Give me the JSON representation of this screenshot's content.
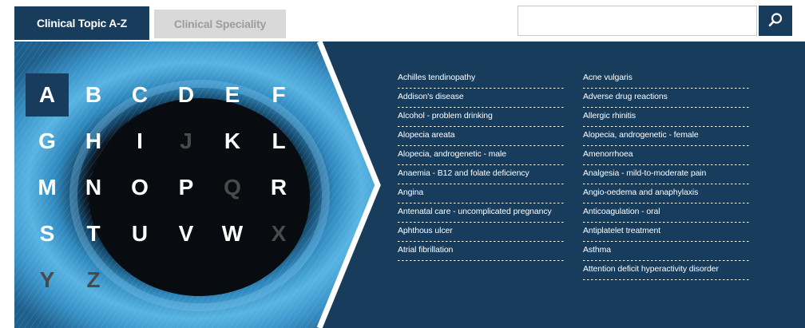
{
  "tabs": [
    {
      "label": "Clinical Topic A-Z",
      "active": true
    },
    {
      "label": "Clinical Speciality",
      "active": false
    }
  ],
  "search": {
    "placeholder": "",
    "icon": "search-icon"
  },
  "colors": {
    "navy": "#173c5c",
    "tab_inactive_bg": "#d9d9d9",
    "tab_inactive_text": "#9d9d9d",
    "eye_blue": "#3f9fd2"
  },
  "letters": [
    {
      "letter": "A",
      "state": "active"
    },
    {
      "letter": "B",
      "state": "enabled"
    },
    {
      "letter": "C",
      "state": "enabled"
    },
    {
      "letter": "D",
      "state": "enabled"
    },
    {
      "letter": "E",
      "state": "enabled"
    },
    {
      "letter": "F",
      "state": "enabled"
    },
    {
      "letter": "G",
      "state": "enabled"
    },
    {
      "letter": "H",
      "state": "enabled"
    },
    {
      "letter": "I",
      "state": "enabled"
    },
    {
      "letter": "J",
      "state": "disabled"
    },
    {
      "letter": "K",
      "state": "enabled"
    },
    {
      "letter": "L",
      "state": "enabled"
    },
    {
      "letter": "M",
      "state": "enabled"
    },
    {
      "letter": "N",
      "state": "enabled"
    },
    {
      "letter": "O",
      "state": "enabled"
    },
    {
      "letter": "P",
      "state": "enabled"
    },
    {
      "letter": "Q",
      "state": "disabled"
    },
    {
      "letter": "R",
      "state": "enabled"
    },
    {
      "letter": "S",
      "state": "enabled"
    },
    {
      "letter": "T",
      "state": "enabled"
    },
    {
      "letter": "U",
      "state": "enabled"
    },
    {
      "letter": "V",
      "state": "enabled"
    },
    {
      "letter": "W",
      "state": "enabled"
    },
    {
      "letter": "X",
      "state": "disabled"
    },
    {
      "letter": "Y",
      "state": "disabled"
    },
    {
      "letter": "Z",
      "state": "disabled"
    }
  ],
  "topics_col1": [
    "Achilles tendinopathy",
    "Addison's disease",
    "Alcohol - problem drinking",
    "Alopecia areata",
    "Alopecia, androgenetic - male",
    "Anaemia - B12 and folate deficiency",
    "Angina",
    "Antenatal care - uncomplicated pregnancy",
    "Aphthous ulcer",
    "Atrial fibrillation"
  ],
  "topics_col2": [
    "Acne vulgaris",
    "Adverse drug reactions",
    "Allergic rhinitis",
    "Alopecia, androgenetic - female",
    "Amenorrhoea",
    "Analgesia - mild-to-moderate pain",
    "Angio-oedema and anaphylaxis",
    "Anticoagulation - oral",
    "Antiplatelet treatment",
    "Asthma",
    "Attention deficit hyperactivity disorder"
  ]
}
